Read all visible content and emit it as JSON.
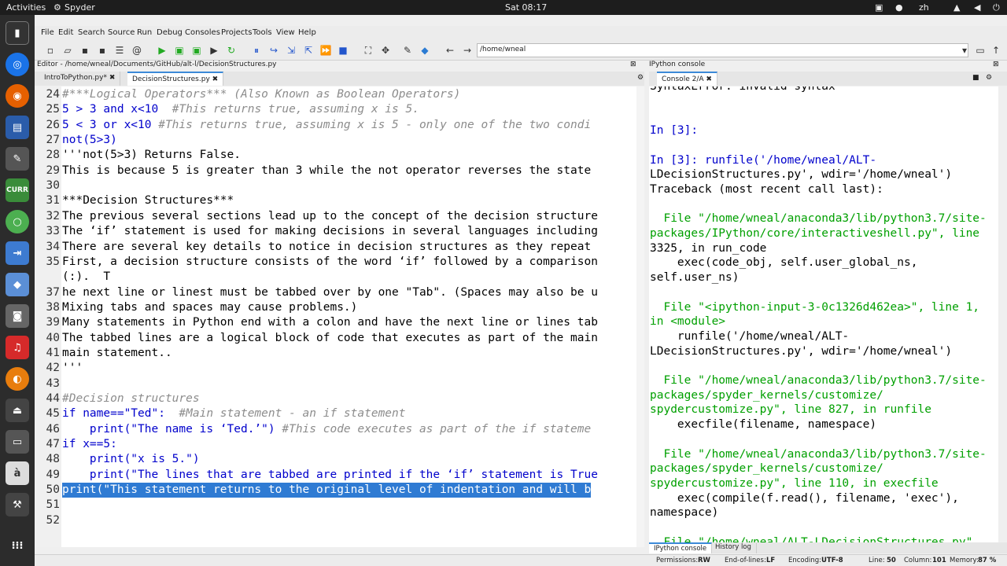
{
  "topbar": {
    "activities": "Activities",
    "app": "Spyder",
    "clock": "Sat 08:17",
    "lang": "zh"
  },
  "menu": [
    "File",
    "Edit",
    "Search",
    "Source",
    "Run",
    "Debug",
    "Consoles",
    "Projects",
    "Tools",
    "View",
    "Help"
  ],
  "toolbar": {
    "path": "/home/wneal"
  },
  "editor": {
    "title": "Editor - /home/wneal/Documents/GitHub/alt-l/DecisionStructures.py",
    "tabs": [
      "IntroToPython.py*",
      "DecisionStructures.py"
    ],
    "lines": [
      {
        "n": "24",
        "code": "#***Logical Operators*** (Also Known as Boolean Operators)",
        "cls": "cmt"
      },
      {
        "n": "25",
        "code": "5 > 3 and x<10  ",
        "comment": "#This returns true, assuming x is 5."
      },
      {
        "n": "26",
        "code": "5 < 3 or x<10 ",
        "comment": "#This returns true, assuming x is 5 - only one of the two condi"
      },
      {
        "n": "27",
        "code": "not(5>3)"
      },
      {
        "n": "28",
        "code": "'''not(5>3) Returns False.",
        "cls": "str"
      },
      {
        "n": "29",
        "code": "This is because 5 is greater than 3 while the not operator reverses the state",
        "cls": "str"
      },
      {
        "n": "30",
        "code": ""
      },
      {
        "n": "31",
        "code": "***Decision Structures***",
        "cls": "str"
      },
      {
        "n": "32",
        "code": "The previous several sections lead up to the concept of the decision structure",
        "cls": "str"
      },
      {
        "n": "33",
        "code": "The ‘if’ statement is used for making decisions in several languages including",
        "cls": "str"
      },
      {
        "n": "34",
        "code": "There are several key details to notice in decision structures as they repeat",
        "cls": "str"
      },
      {
        "n": "35",
        "code": "First, a decision structure consists of the word ‘if’ followed by a comparison",
        "cls": "str"
      },
      {
        "n": "",
        "code": "(:).  T",
        "cls": "str"
      },
      {
        "n": "37",
        "code": "he next line or linest must be tabbed over by one \"Tab\". (Spaces may also be u",
        "cls": "str"
      },
      {
        "n": "38",
        "code": "Mixing tabs and spaces may cause problems.)",
        "cls": "str"
      },
      {
        "n": "39",
        "code": "Many statements in Python end with a colon and have the next line or lines tab",
        "cls": "str"
      },
      {
        "n": "40",
        "code": "The tabbed lines are a logical block of code that executes as part of the main",
        "cls": "str"
      },
      {
        "n": "41",
        "code": "main statement..",
        "cls": "str"
      },
      {
        "n": "42",
        "code": "'''",
        "cls": "str"
      },
      {
        "n": "43",
        "code": ""
      },
      {
        "n": "44",
        "code": "#Decision structures",
        "cls": "cmt"
      },
      {
        "n": "45",
        "code": "if name==\"Ted\":  ",
        "comment": "#Main statement - an if statement"
      },
      {
        "n": "46",
        "code": "    print(\"The name is ‘Ted.’\") ",
        "comment": "#This code executes as part of the if stateme"
      },
      {
        "n": "47",
        "code": "if x==5:"
      },
      {
        "n": "48",
        "code": "    print(\"x is 5.\")"
      },
      {
        "n": "49",
        "code": "    print(\"The lines that are tabbed are printed if the ‘if’ statement is True"
      },
      {
        "n": "50",
        "code": "print(\"This statement returns to the original level of indentation and will b",
        "cls": "hl"
      },
      {
        "n": "51",
        "code": ""
      },
      {
        "n": "52",
        "code": ""
      }
    ]
  },
  "console": {
    "title": "IPython console",
    "tab": "Console 2/A",
    "lines": [
      "SyntaxError: invalid syntax",
      "",
      "",
      "In [3]:",
      "",
      "In [3]: runfile('/home/wneal/ALT-",
      "LDecisionStructures.py', wdir='/home/wneal')",
      "Traceback (most recent call last):",
      "",
      "  File \"/home/wneal/anaconda3/lib/python3.7/site-",
      "packages/IPython/core/interactiveshell.py\", line",
      "3325, in run_code",
      "    exec(code_obj, self.user_global_ns,",
      "self.user_ns)",
      "",
      "  File \"<ipython-input-3-0c1326d462ea>\", line 1,",
      "in <module>",
      "    runfile('/home/wneal/ALT-",
      "LDecisionStructures.py', wdir='/home/wneal')",
      "",
      "  File \"/home/wneal/anaconda3/lib/python3.7/site-",
      "packages/spyder_kernels/customize/",
      "spydercustomize.py\", line 827, in runfile",
      "    execfile(filename, namespace)",
      "",
      "  File \"/home/wneal/anaconda3/lib/python3.7/site-",
      "packages/spyder_kernels/customize/",
      "spydercustomize.py\", line 110, in execfile",
      "    exec(compile(f.read(), filename, 'exec'),",
      "namespace)",
      "",
      "  File \"/home/wneal/ALT-LDecisionStructures.py\""
    ],
    "bottom_tabs": [
      "IPython console",
      "History log"
    ]
  },
  "status": {
    "permissions_label": "Permissions:",
    "permissions": "RW",
    "eol_label": "End-of-lines:",
    "eol": "LF",
    "encoding_label": "Encoding:",
    "encoding": "UTF-8",
    "line_label": "Line:",
    "line": "50",
    "column_label": "Column:",
    "column": "101",
    "memory_label": "Memory:",
    "memory": "87 %"
  },
  "colors": {
    "accent": "#3c8ad8",
    "highlight": "#2f7bd3",
    "keyword": "#0000cc",
    "comment": "#8c8c8c",
    "string_green": "#00aa00"
  }
}
